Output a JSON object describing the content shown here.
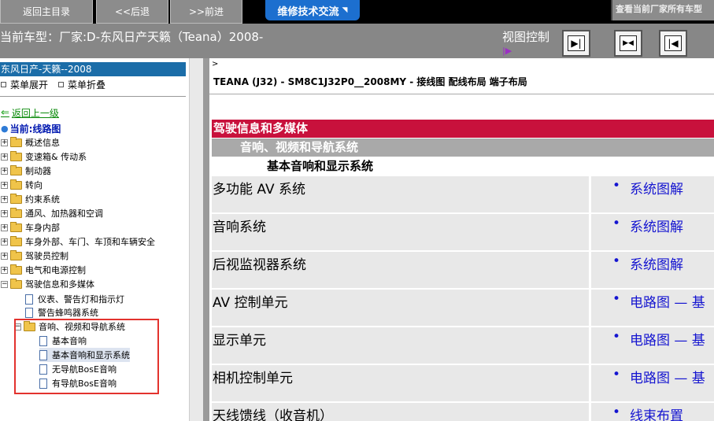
{
  "topbar": {
    "home_label": "返回主目录",
    "back_label": "<<后退",
    "forward_label": ">>前进",
    "forum_tab": "维修技术交流",
    "query_label": "查看当前厂家所有车型"
  },
  "info": {
    "current_model": "当前车型：厂家:D-东风日产天籁（Teana）2008-",
    "view_control": "视图控制",
    "view_mark": "|▶"
  },
  "tree": {
    "header": "东风日产-天籁--2008",
    "expand": "菜单展开",
    "collapse": "菜单折叠",
    "back_up": "返回上一级",
    "current": "当前:线路图",
    "nodes": [
      {
        "label": "概述信息"
      },
      {
        "label": "变速箱& 传动系"
      },
      {
        "label": "制动器"
      },
      {
        "label": "转向"
      },
      {
        "label": "约束系统"
      },
      {
        "label": "通风、加热器和空调"
      },
      {
        "label": "车身内部"
      },
      {
        "label": "车身外部、车门、车顶和车辆安全"
      },
      {
        "label": "驾驶员控制"
      },
      {
        "label": "电气和电源控制"
      },
      {
        "label": "驾驶信息和多媒体"
      }
    ],
    "sub_nodes": [
      {
        "label": "仪表、警告灯和指示灯"
      },
      {
        "label": "警告蜂鸣器系统"
      }
    ],
    "av_folder": "音响、视频和导航系统",
    "av_docs": [
      {
        "label": "基本音响"
      },
      {
        "label": "基本音响和显示系统"
      },
      {
        "label": "无导航BosE音响"
      },
      {
        "label": "有导航BosE音响"
      }
    ]
  },
  "main": {
    "prompt": ">",
    "doc_title": "TEANA (J32) - SM8C1J32P0__2008MY - 接线图 配线布局 端子布局",
    "section1": "驾驶信息和多媒体",
    "section2": "音响、视频和导航系统",
    "section3": "基本音响和显示系统",
    "rows": [
      {
        "name": "多功能 AV 系统",
        "link": "系统图解"
      },
      {
        "name": "音响系统",
        "link": "系统图解"
      },
      {
        "name": "后视监视器系统",
        "link": "系统图解"
      },
      {
        "name": "AV 控制单元",
        "link": "电路图 — 基"
      },
      {
        "name": "显示单元",
        "link": "电路图 — 基"
      },
      {
        "name": "相机控制单元",
        "link": "电路图 — 基"
      },
      {
        "name": "天线馈线（收音机）",
        "link": "线束布置"
      }
    ]
  },
  "colors": {
    "section1_bg": "#c8113c",
    "section2_bg": "#a9a9a9",
    "tree_header_bg": "#1b6da8",
    "link": "#1515d0",
    "highlight_box": "#e3322e"
  }
}
